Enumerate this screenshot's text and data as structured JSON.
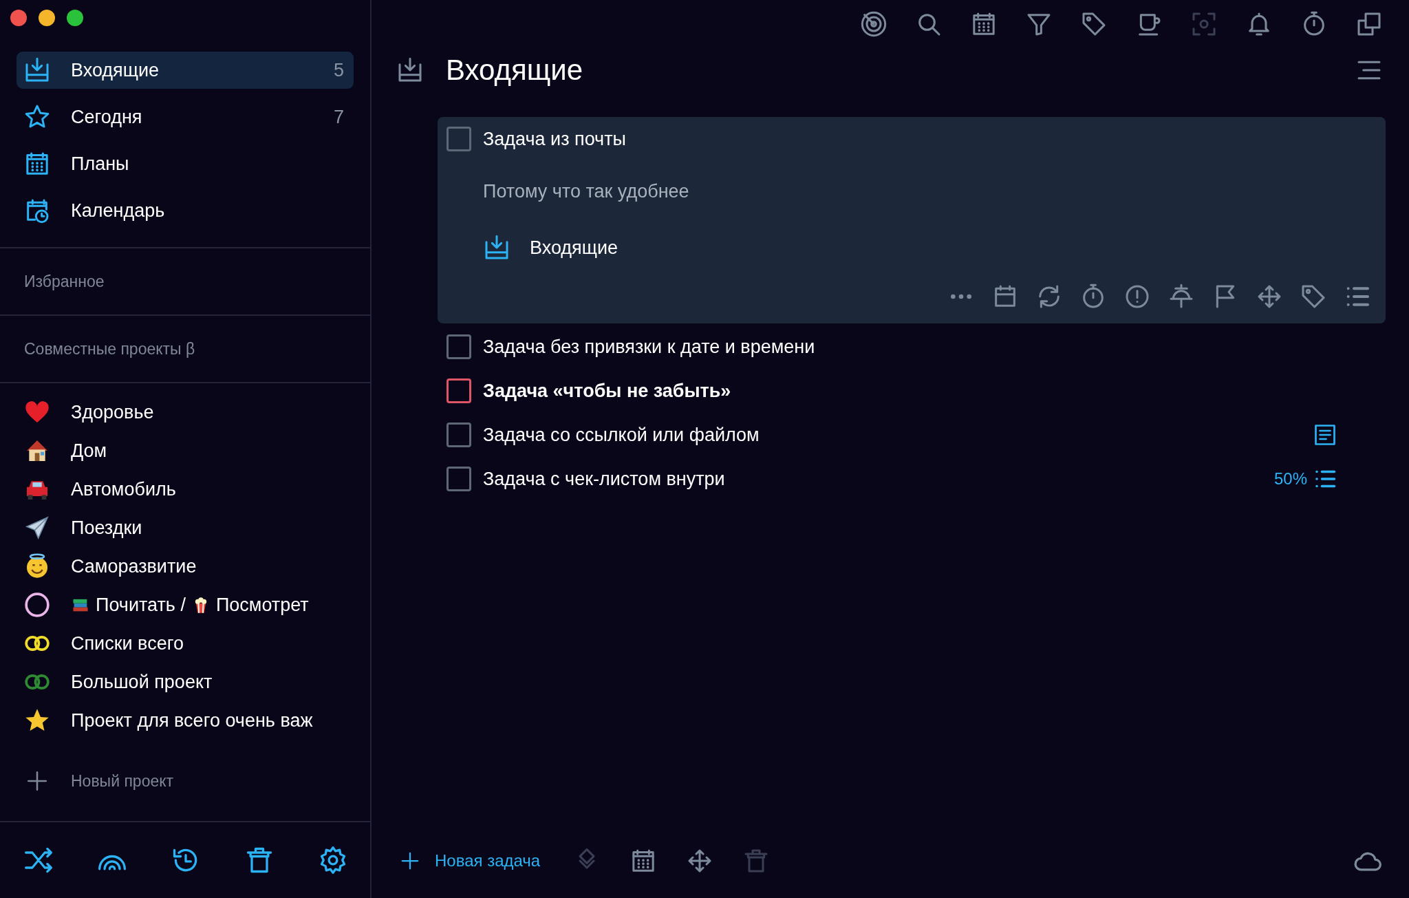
{
  "sidebar": {
    "nav": [
      {
        "label": "Входящие",
        "count": "5",
        "selected": true
      },
      {
        "label": "Сегодня",
        "count": "7",
        "selected": false
      },
      {
        "label": "Планы",
        "selected": false
      },
      {
        "label": "Календарь",
        "selected": false
      }
    ],
    "sections": [
      {
        "title": "Избранное"
      },
      {
        "title": "Совместные проекты β"
      }
    ],
    "projects": [
      {
        "label": "Здоровье"
      },
      {
        "label": "Дом"
      },
      {
        "label": "Автомобиль"
      },
      {
        "label": "Поездки"
      },
      {
        "label": "Саморазвитие"
      },
      {
        "segments": [
          "Почитать /",
          "Посмотрет"
        ],
        "color": "#eab5e8"
      },
      {
        "label": "Списки всего",
        "color": "#f2dc2a"
      },
      {
        "label": "Большой проект",
        "color": "#2f8a34"
      },
      {
        "label": "Проект для всего очень важ"
      }
    ],
    "new_project": "Новый проект"
  },
  "main": {
    "title": "Входящие",
    "tasks": [
      {
        "title": "Задача из почты",
        "checked": false,
        "important": false,
        "expanded": true,
        "note": "Потому что так удобнее",
        "project": "Входящие",
        "attachment": false
      },
      {
        "title": "Задача без привязки к дате и времени",
        "checked": false,
        "important": false,
        "expanded": false,
        "attachment": false
      },
      {
        "title": "Задача «чтобы не забыть»",
        "checked": false,
        "important": true,
        "expanded": false,
        "attachment": false
      },
      {
        "title": "Задача со ссылкой или файлом",
        "checked": false,
        "important": false,
        "expanded": false,
        "attachment": true
      },
      {
        "title": "Задача с чек-листом внутри",
        "checked": false,
        "important": false,
        "expanded": false,
        "attachment": false,
        "checklist": "50%"
      }
    ],
    "new_task": "Новая задача",
    "bottom_tools": [
      {
        "disabled": true
      },
      {
        "disabled": false
      },
      {
        "disabled": false
      },
      {
        "disabled": true
      }
    ]
  }
}
